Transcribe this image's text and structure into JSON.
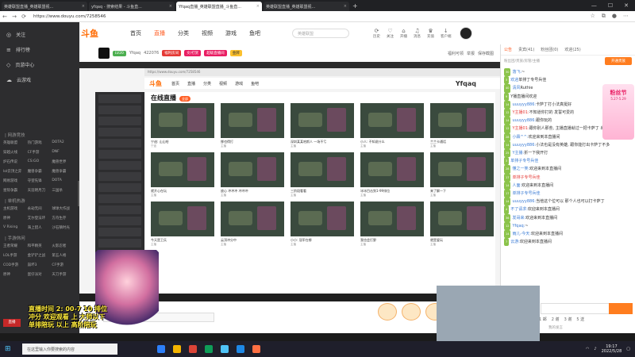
{
  "tabs": [
    {
      "label": "英雄联盟直播_英雄联盟视...",
      "active": false
    },
    {
      "label": "yfqaq - 搜索结果 - 斗鱼直...",
      "active": false
    },
    {
      "label": "Yfqaq直播_英雄联盟直播_斗鱼直...",
      "active": true
    },
    {
      "label": "英雄联盟直播_英雄联盟视...",
      "active": false
    }
  ],
  "address": {
    "url": "https://www.douyu.com/7258546"
  },
  "site": {
    "logo": "斗鱼",
    "nav": [
      "首页",
      "直播",
      "分类",
      "视频",
      "游戏",
      "鱼吧"
    ],
    "active_nav": "直播",
    "search_placeholder": "英雄联盟",
    "top_icons": [
      {
        "icon": "history-icon",
        "glyph": "⟳",
        "label": "历史"
      },
      {
        "icon": "heart-icon",
        "glyph": "♡",
        "label": "关注"
      },
      {
        "icon": "gift-icon",
        "glyph": "⌂",
        "label": "开播"
      },
      {
        "icon": "bell-icon",
        "glyph": "♫",
        "label": "消息"
      },
      {
        "icon": "crown-icon",
        "glyph": "♛",
        "label": "充值"
      },
      {
        "icon": "download-icon",
        "glyph": "↓",
        "label": "客户端"
      }
    ]
  },
  "sidebar": {
    "items": [
      {
        "icon": "◎",
        "label": "关注"
      },
      {
        "icon": "≡",
        "label": "排行榜"
      },
      {
        "icon": "◇",
        "label": "页游中心"
      },
      {
        "icon": "☁",
        "label": "云游戏"
      }
    ],
    "sections": [
      {
        "title": "| 网游竞技",
        "games": [
          "英雄联盟",
          "热门游戏",
          "DOTA2",
          "穿越火线",
          "CF手游",
          "DNF",
          "炉石传说",
          "CS:GO",
          "魔兽世界",
          "lol云顶之弈",
          "魔兽争霸",
          "魔兽争霸",
          "网易游戏",
          "守望先锋",
          "DOTA",
          "星际争霸",
          "天涯明月刀",
          "三国杀"
        ]
      },
      {
        "title": "| 单机热游",
        "games": [
          "主机游戏",
          "永劫无间",
          "球球大作战",
          "原神",
          "艾尔登法环",
          "方舟生存",
          "V Rising",
          "海上猎人",
          "沙石镇时光"
        ]
      },
      {
        "title": "| 手游休闲",
        "games": [
          "王者荣耀",
          "和平精英",
          "火影忍者",
          "LOL手游",
          "金铲铲之战",
          "第五人格",
          "COD手游",
          "崩坏3",
          "CF手游",
          "原神",
          "蛋仔派对",
          "天刀手游"
        ]
      }
    ],
    "bottom_badge": "直播"
  },
  "room": {
    "badges": [
      "LV20",
      "Yfqaq",
      "422076",
      "福利房间",
      "文/打赏",
      "超级直播间",
      "金牌"
    ],
    "follow": "关注",
    "fans_text": "福利可领",
    "report": "举报",
    "save": "保存截图"
  },
  "inner": {
    "nav": [
      "首页",
      "直播",
      "分类",
      "视频",
      "游戏",
      "鱼吧"
    ],
    "title": "在线直播",
    "tag": "全部",
    "streamer_name": "Yfqaq",
    "cards": [
      {
        "title": "宁迪: 山山哈",
        "sub": "宁迪"
      },
      {
        "title": "挪也得打",
        "sub": "主播"
      },
      {
        "title": "深圳某某哈斯人 一场不亏",
        "sub": "主播"
      },
      {
        "title": "小人: 不知说什么",
        "sub": "主播"
      },
      {
        "title": "兰兰卡通话",
        "sub": "主播"
      },
      {
        "title": "就开心在玩",
        "sub": "主播"
      },
      {
        "title": "放心 冲冲冲 冲冲冲",
        "sub": "主播"
      },
      {
        "title": "三阶段看看",
        "sub": "主播"
      },
      {
        "title": "冰冰目击到1-99排位",
        "sub": "主播"
      },
      {
        "title": "来了解一下",
        "sub": "主播"
      },
      {
        "title": "今天是卫兵",
        "sub": "主播"
      },
      {
        "title": "云顶冲分中",
        "sub": "主播"
      },
      {
        "title": "小小: 冠军在哪",
        "sub": "主播"
      },
      {
        "title": "我也会打野",
        "sub": "主播"
      },
      {
        "title": "就是爱玩",
        "sub": "主播"
      }
    ]
  },
  "overlay": {
    "text": "直播时间 2: 00-7 10 排位冲分 欢迎观看 上 大师以下 单排陪玩 以上 高阶陪玩"
  },
  "player": {
    "input_placeholder": "[分享] 公屏 [可领取]"
  },
  "chat": {
    "tabs": [
      "公告",
      "贵宾(41)",
      "粉丝团(0)",
      "欢迎(25)"
    ],
    "active_tab": "公告",
    "sub_text": "粉丝团/贵族/房管/主播",
    "open_btn": "开通贵族",
    "messages": [
      {
        "lv": "30",
        "name": "落飞:",
        "text": "~",
        "red": false
      },
      {
        "lv": "3",
        "name": "欢迎",
        "text": "单排丁专号兵佳",
        "red": false
      },
      {
        "lv": "40",
        "name": "清风",
        "text": "Ruthie",
        "red": false
      },
      {
        "lv": "9",
        "name": "",
        "text": "Y播直播间欢迎",
        "red": false
      },
      {
        "lv": "14",
        "name": "uuuyyy886:",
        "text": "卡萨丁打小法真挺好",
        "red": false
      },
      {
        "lv": "12",
        "name": "Y主播01:",
        "text": "不知道你打的 发誓可爱的",
        "red": true
      },
      {
        "lv": "14",
        "name": "uuuyyy886:",
        "text": "跟你玩的",
        "red": false
      },
      {
        "lv": "12",
        "name": "Y主播01:",
        "text": "跟你别人那些, 主播直播就过一把卡萨丁 出卡萨丁吧",
        "red": true
      },
      {
        "lv": "28",
        "name": "小霖^^:",
        "text": "欢迎来到本直播间",
        "red": false
      },
      {
        "lv": "14",
        "name": "uuuyyy886:",
        "text": "小法也是没有英雄, 跟你能打出卡萨丁不多",
        "red": false
      },
      {
        "lv": "25",
        "name": "Y主播:",
        "text": "折一下我开打",
        "red": false
      },
      {
        "lv": "3",
        "name": "单排子专号兵佳",
        "text": "",
        "red": false
      },
      {
        "lv": "28",
        "name": "懂之一笑:",
        "text": "欢迎来到本直播间",
        "red": false
      },
      {
        "lv": "17",
        "name": "单排子专号兵佳",
        "text": "",
        "red": true
      },
      {
        "lv": "14",
        "name": "人面:",
        "text": "欢迎来到本直播间",
        "red": false
      },
      {
        "lv": "17",
        "name": "单排子专号兵佳",
        "text": "",
        "red": false
      },
      {
        "lv": "14",
        "name": "uuuyyy886:",
        "text": "当他这个位可以 那个人也可以打卡萨丁",
        "red": false
      },
      {
        "lv": "4",
        "name": "不了请求:",
        "text": "欢迎来到本直播间",
        "red": false
      },
      {
        "lv": "36",
        "name": "发哥来:",
        "text": "欢迎来到本直播间",
        "red": false
      },
      {
        "lv": "12",
        "name": "Yfqaq:",
        "text": "~",
        "red": false
      },
      {
        "lv": "14",
        "name": "雨儿-今天:",
        "text": "欢迎来到本直播间",
        "red": false
      },
      {
        "lv": "7",
        "name": "云游:",
        "text": "欢迎来到本直播间",
        "red": false
      }
    ],
    "tools": [
      "1 邮",
      "2 谢",
      "3 谢",
      "5 送"
    ],
    "my_fans": "我的发言",
    "promo_title": "粉丝节",
    "promo_sub": "5.27-5.29"
  },
  "taskbar": {
    "search_placeholder": "在这里输入你要搜索的内容",
    "time": "19:17",
    "date": "2022/5/28",
    "apps": [
      "#2d7ff9",
      "#f4b400",
      "#db4437",
      "#0f9d58",
      "#4fc3f7",
      "#1e88e5",
      "#ff7043"
    ]
  },
  "colors": {
    "accent": "#ff5d23",
    "chrome_dark": "#202124",
    "sidebar": "#2d2d2f"
  }
}
